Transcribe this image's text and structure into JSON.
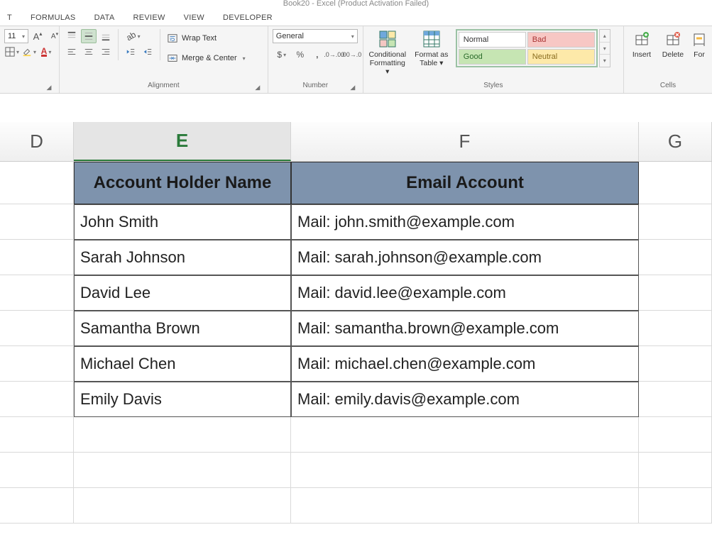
{
  "title": "Book20 - Excel (Product Activation Failed)",
  "tabs": {
    "t0": "T",
    "formulas": "FORMULAS",
    "data": "DATA",
    "review": "REVIEW",
    "view": "VIEW",
    "developer": "DEVELOPER"
  },
  "ribbon": {
    "font": {
      "size": "11",
      "grow": "A",
      "shrink": "A",
      "fill_dd": "▾",
      "fontcolor_dd": "▾",
      "label": ""
    },
    "alignment": {
      "wrap": "Wrap Text",
      "merge": "Merge & Center",
      "label": "Alignment"
    },
    "number": {
      "format": "General",
      "label": "Number"
    },
    "styles": {
      "conditional": "Conditional Formatting ▾",
      "formatas": "Format as Table ▾",
      "normal": "Normal",
      "bad": "Bad",
      "good": "Good",
      "neutral": "Neutral",
      "label": "Styles"
    },
    "cells": {
      "insert": "Insert",
      "delete": "Delete",
      "format": "For",
      "label": "Cells"
    }
  },
  "columns": {
    "D": "D",
    "E": "E",
    "F": "F",
    "G": "G"
  },
  "table": {
    "header": {
      "name": "Account Holder Name",
      "email": "Email Account"
    },
    "rows": [
      {
        "name": "John Smith",
        "email": "Mail: john.smith@example.com"
      },
      {
        "name": "Sarah Johnson",
        "email": "Mail: sarah.johnson@example.com"
      },
      {
        "name": "David Lee",
        "email": "Mail: david.lee@example.com"
      },
      {
        "name": "Samantha Brown",
        "email": "Mail: samantha.brown@example.com"
      },
      {
        "name": "Michael Chen",
        "email": "Mail: michael.chen@example.com"
      },
      {
        "name": "Emily Davis",
        "email": "Mail: emily.davis@example.com"
      }
    ]
  }
}
